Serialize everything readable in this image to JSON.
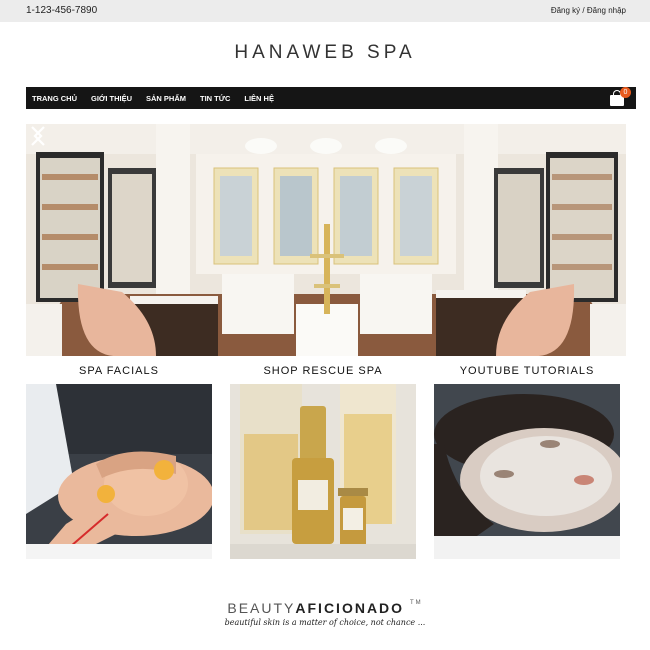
{
  "topbar": {
    "phone": "1-123-456-7890",
    "register": "Đăng ký",
    "separator": " / ",
    "login": "Đăng nhập"
  },
  "site": {
    "logo": "HANAWEB SPA"
  },
  "nav": {
    "items": [
      {
        "label": "TRANG CHỦ"
      },
      {
        "label": "GIỚI THIỆU"
      },
      {
        "label": "SẢN PHẨM"
      },
      {
        "label": "TIN TỨC"
      },
      {
        "label": "LIÊN HỆ"
      }
    ],
    "cart_count": "0",
    "cart_icon": "shopping-bag-icon"
  },
  "slider": {
    "image": "spa-store-interior",
    "prev_icon": "chevron-left-icon",
    "next_icon": "chevron-right-icon"
  },
  "categories": [
    {
      "label": "SPA FACIALS",
      "image": "facial-treatment-photo"
    },
    {
      "label": "SHOP RESCUE SPA",
      "image": "serum-bottles-photo"
    },
    {
      "label": "YOUTUBE TUTORIALS",
      "image": "face-mask-photo"
    }
  ],
  "footer": {
    "brand_light": "BEAUTY",
    "brand_bold": "AFICIONADO",
    "trademark": "TM",
    "tagline": "beautiful skin is a matter of choice, not chance ..."
  },
  "colors": {
    "nav_bg": "#151515",
    "topbar_bg": "#ececec",
    "badge": "#e85a1d"
  }
}
